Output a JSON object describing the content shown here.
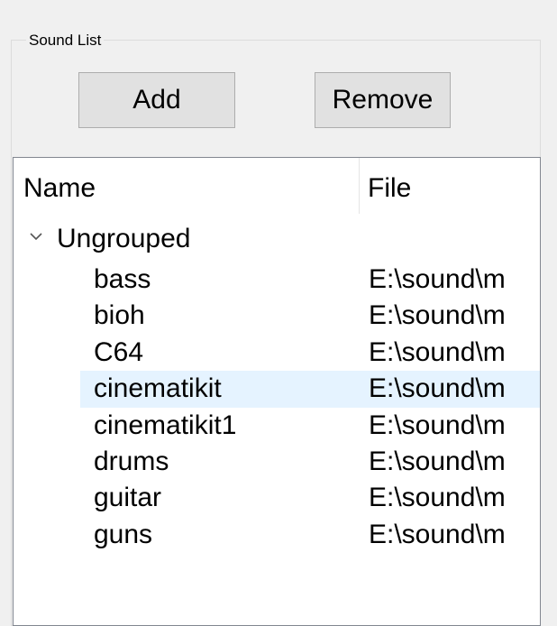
{
  "sound_list": {
    "title": "Sound List",
    "add_label": "Add",
    "remove_label": "Remove"
  },
  "listview": {
    "columns": [
      {
        "label": "Name"
      },
      {
        "label": "File"
      }
    ],
    "group": {
      "label": "Ungrouped",
      "expanded": true,
      "icon": "chevron-down-icon"
    },
    "rows": [
      {
        "name": "bass",
        "file": "E:\\sound\\m"
      },
      {
        "name": "bioh",
        "file": "E:\\sound\\m"
      },
      {
        "name": "C64",
        "file": "E:\\sound\\m"
      },
      {
        "name": "cinematikit",
        "file": "E:\\sound\\m",
        "selected": true
      },
      {
        "name": "cinematikit1",
        "file": "E:\\sound\\m"
      },
      {
        "name": "drums",
        "file": "E:\\sound\\m"
      },
      {
        "name": "guitar",
        "file": "E:\\sound\\m"
      },
      {
        "name": "guns",
        "file": "E:\\sound\\m"
      }
    ]
  },
  "colors": {
    "window_bg": "#f0f0f0",
    "list_bg": "#ffffff",
    "selection_bg": "#e5f3ff",
    "button_bg": "#e1e1e1",
    "button_border": "#adadad"
  }
}
